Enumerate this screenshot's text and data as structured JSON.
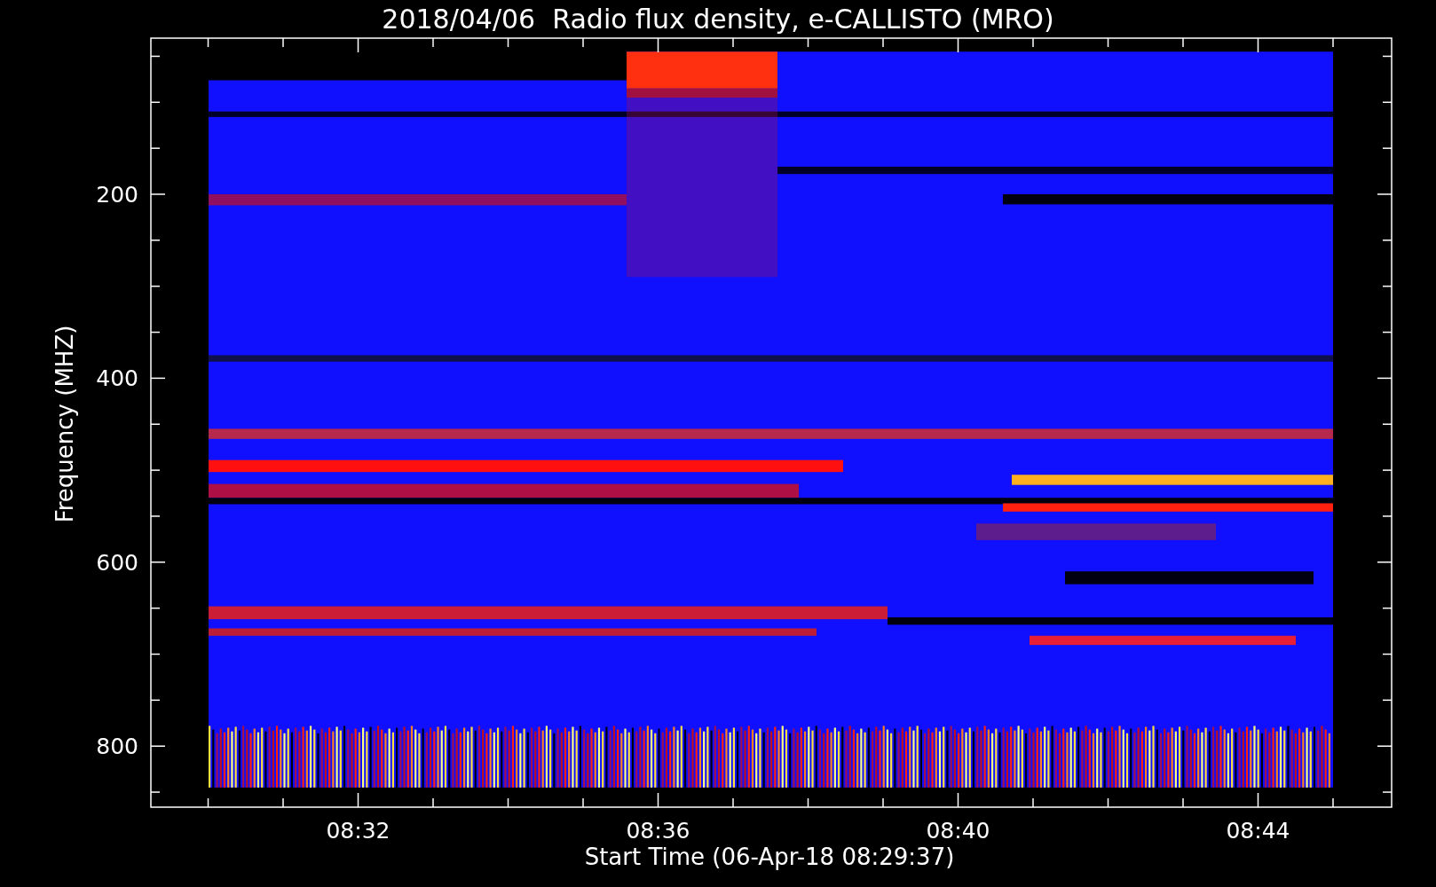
{
  "title": "2018/04/06  Radio flux density, e-CALLISTO (MRO)",
  "chart": {
    "ylabel": "Frequency (MHZ)",
    "xlabel": "Start Time (06-Apr-18 08:29:37)",
    "yticks": [
      "200",
      "400",
      "600",
      "800"
    ],
    "xticks": [
      "08:32",
      "08:36",
      "08:40",
      "08:44"
    ]
  }
}
